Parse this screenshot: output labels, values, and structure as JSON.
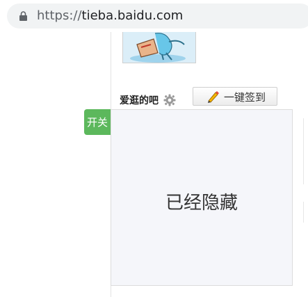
{
  "browser": {
    "url_prefix": "https://",
    "url_host": "tieba.baidu.com"
  },
  "panel": {
    "title": "爱逛的吧",
    "sign_button_label": "一键签到",
    "toggle_label": "开关",
    "hidden_message": "已经隐藏"
  }
}
